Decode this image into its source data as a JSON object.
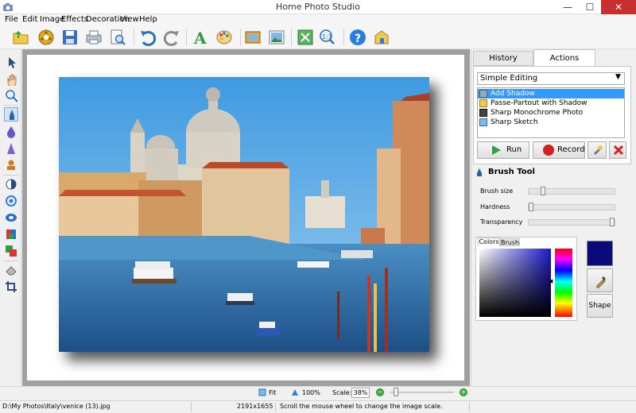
{
  "window": {
    "title": "Home Photo Studio",
    "minimize": "—",
    "maximize": "☐",
    "close": "✕"
  },
  "menu": [
    "File",
    "Edit",
    "Image",
    "Effects",
    "Decoration",
    "View",
    "Help"
  ],
  "toolbar_icons": [
    "open-folder-icon",
    "film-reel-icon",
    "save-icon",
    "print-icon",
    "print-preview-icon",
    "undo-icon",
    "redo-icon",
    "text-icon",
    "palette-icon",
    "frame-icon",
    "picture-icon",
    "fit-screen-icon",
    "actual-size-icon",
    "help-icon",
    "home-box-icon"
  ],
  "left_tools": [
    "pointer-icon",
    "hand-icon",
    "zoom-icon",
    "brush-icon",
    "blur-drop-icon",
    "sharpen-cone-icon",
    "stamp-icon",
    "brightness-icon",
    "contrast-icon",
    "saturation-icon",
    "color-balance-icon",
    "color-replace-icon",
    "eraser-icon",
    "crop-icon"
  ],
  "right_panel": {
    "tabs": {
      "history": "History",
      "actions": "Actions"
    },
    "mode_select": "Simple Editing",
    "actions": [
      {
        "label": "Add Shadow",
        "selected": true
      },
      {
        "label": "Passe-Partout with Shadow",
        "selected": false
      },
      {
        "label": "Sharp Monochrome Photo",
        "selected": false
      },
      {
        "label": "Sharp Sketch",
        "selected": false
      }
    ],
    "run_label": "Run",
    "record_label": "Record"
  },
  "brush_tool": {
    "title": "Brush Tool",
    "sliders": [
      {
        "label": "Brush size",
        "value": 0.15
      },
      {
        "label": "Hardness",
        "value": 0.0
      },
      {
        "label": "Transparency",
        "value": 1.0
      }
    ],
    "tabs": {
      "colors": "Colors",
      "brush": "Brush"
    },
    "current_color": "#0a0a78",
    "shape_label": "Shape"
  },
  "zoom_bar": {
    "fit_label": "Fit",
    "full_label": "100%",
    "scale_label": "Scale:",
    "scale_value": "38%",
    "zoom_level": 0.05
  },
  "status": {
    "path": "D:\\My Photos\\Italy\\venice (13).jpg",
    "dimensions": "2191x1655",
    "hint": "Scroll the mouse wheel to change the image scale."
  },
  "colors": {
    "accent_selection": "#3399ff",
    "run_green": "#2ea043",
    "record_red": "#d42020",
    "close_red": "#c7302f"
  }
}
